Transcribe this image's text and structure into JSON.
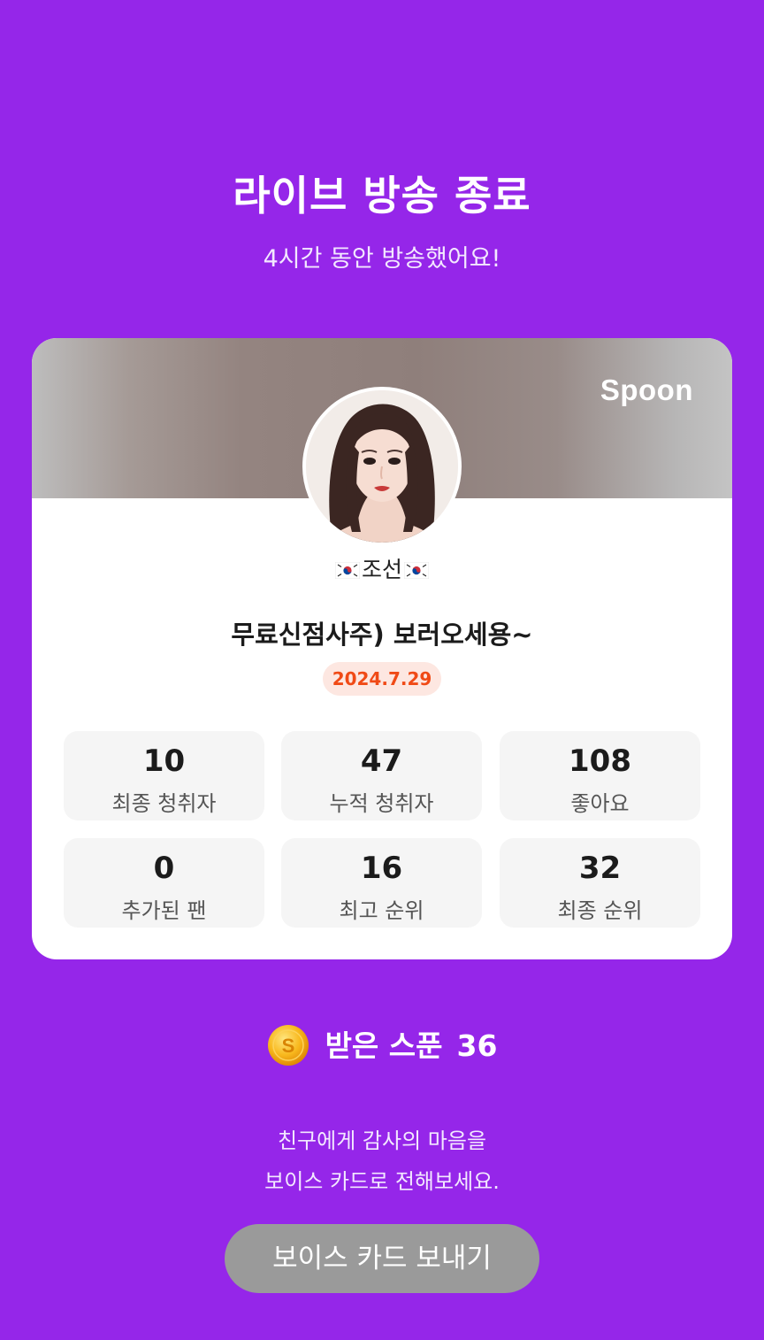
{
  "header": {
    "title": "라이브 방송 종료",
    "subtitle": "4시간 동안 방송했어요!"
  },
  "card": {
    "brand": "Spoon",
    "nickname": "조선",
    "nickname_flag_icon": "south-korea-flag",
    "live_title": "무료신점사주) 보러오세용~",
    "date": "2024.7.29",
    "stats": [
      {
        "value": "10",
        "label": "최종 청취자"
      },
      {
        "value": "47",
        "label": "누적 청취자"
      },
      {
        "value": "108",
        "label": "좋아요"
      },
      {
        "value": "0",
        "label": "추가된 팬"
      },
      {
        "value": "16",
        "label": "최고 순위"
      },
      {
        "value": "32",
        "label": "최종 순위"
      }
    ]
  },
  "spoons": {
    "icon": "spoon-coin-icon",
    "label": "받은 스푼",
    "count": "36"
  },
  "message": {
    "line1": "친구에게 감사의 마음을",
    "line2": "보이스 카드로 전해보세요."
  },
  "cta": {
    "label": "보이스 카드 보내기"
  },
  "colors": {
    "background": "#9526e9",
    "date_accent": "#f04a16",
    "button": "#9a9a9a"
  }
}
